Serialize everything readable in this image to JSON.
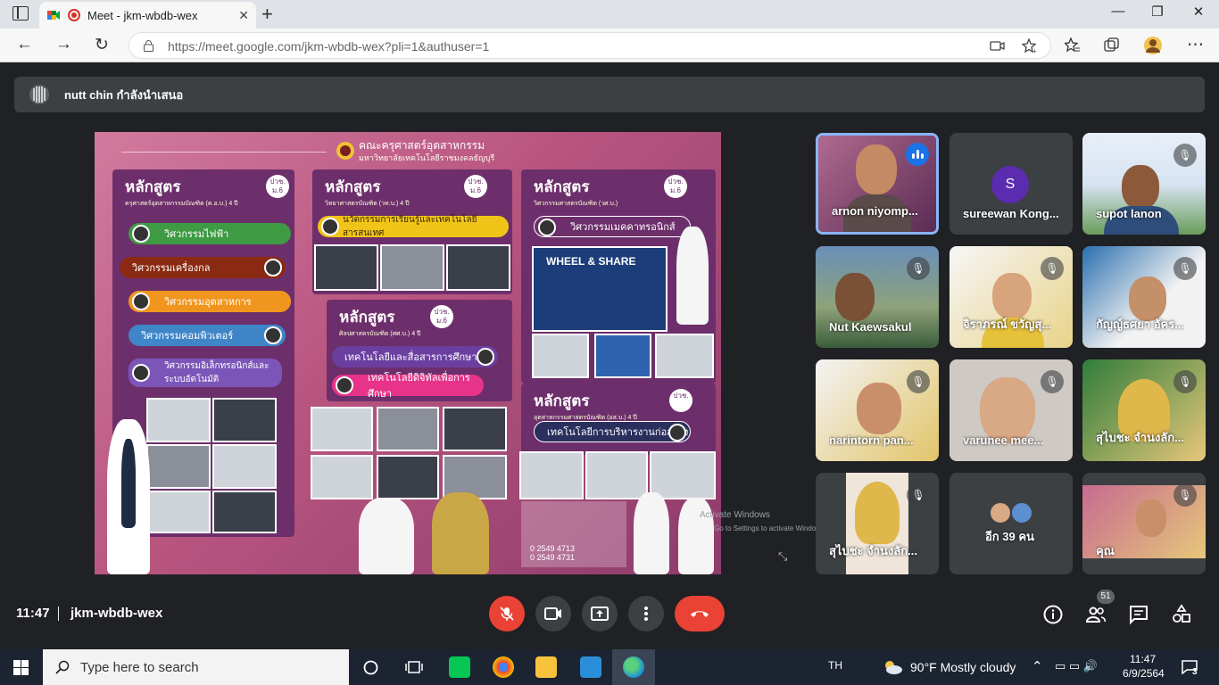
{
  "browser": {
    "tab_title": "Meet - jkm-wbdb-wex",
    "tab_close": "✕",
    "new_tab": "+",
    "url_host": "https://meet.google.com",
    "url_path": "/jkm-wbdb-wex?pli=1&authuser=1",
    "window_controls": [
      "—",
      "❐",
      "✕"
    ]
  },
  "meet": {
    "presenting_banner": "nutt chin กำลังนำเสนอ",
    "time": "11:47",
    "meeting_code": "jkm-wbdb-wex",
    "participant_count": "51",
    "watermark_line1": "Activate Windows",
    "watermark_line2": "Go to Settings to activate Windows."
  },
  "slide": {
    "header": "คณะครุศาสตร์อุตสาหกรรม",
    "subheader": "มหาวิทยาลัยเทคโนโลยีราชมงคลธัญบุรี",
    "columns": [
      {
        "title": "หลักสูตร",
        "badge": "ปวช. ม.6",
        "sub": "ครุศาสตร์อุตสาหกรรมบัณฑิต (ค.อ.บ.) 4 ปี",
        "items": [
          "วิศวกรรมไฟฟ้า",
          "วิศวกรรมเครื่องกล",
          "วิศวกรรมอุตสาหการ",
          "วิศวกรรมคอมพิวเตอร์",
          "วิศวกรรมอิเล็กทรอนิกส์และระบบอัตโนมัติ"
        ]
      },
      {
        "title": "หลักสูตร",
        "badge": "ปวช. ม.6",
        "sub": "วิทยาศาสตรบัณฑิต (วท.บ.) 4 ปี",
        "items": [
          "นวัตกรรมการเรียนรู้และเทคโนโลยีสารสนเทศ"
        ]
      },
      {
        "title": "หลักสูตร",
        "badge": "ปวช. ม.6",
        "sub": "ศิลปศาสตรบัณฑิต (ศศ.บ.) 4 ปี",
        "items": [
          "เทคโนโลยีและสื่อสารการศึกษา",
          "เทคโนโลยีดิจิทัลเพื่อการศึกษา"
        ]
      },
      {
        "title": "หลักสูตร",
        "badge": "ปวช. ม.6",
        "sub": "วิศวกรรมศาสตรบัณฑิต (วศ.บ.)",
        "items": [
          "วิศวกรรมเมคคาทรอนิกส์"
        ]
      },
      {
        "title": "หลักสูตร",
        "badge": "ปวช.",
        "sub": "อุตสาหกรรมศาสตรบัณฑิต (อส.บ.) 4 ปี",
        "items": [
          "เทคโนโลยีการบริหารงานก่อสร้าง"
        ]
      }
    ],
    "wheel_share": "WHEEL & SHARE",
    "phone1": "0 2549 4713",
    "phone2": "0 2549 4731"
  },
  "participants": [
    {
      "name": "arnon niyomp...",
      "speaking": true
    },
    {
      "name": "sureewan Kong...",
      "avatar_letter": "S"
    },
    {
      "name": "supot lanon",
      "muted": true
    },
    {
      "name": "Nut Kaewsakul",
      "muted": true
    },
    {
      "name": "จิราภรณ์ ขวัญสุ...",
      "muted": true
    },
    {
      "name": "กัญญ์ธศยา อัคร...",
      "muted": true
    },
    {
      "name": "narintorn pan...",
      "muted": true
    },
    {
      "name": "varunee mee...",
      "muted": true
    },
    {
      "name": "สุไบชะ จำนงลัก...",
      "muted": true
    },
    {
      "name": "สุไบชะ จำนงลัก...",
      "muted": true
    },
    {
      "name": "อีก 39 คน"
    },
    {
      "name": "คุณ",
      "muted": true
    }
  ],
  "taskbar": {
    "search_placeholder": "Type here to search",
    "lang": "TH",
    "weather": "90°F  Mostly cloudy",
    "time": "11:47",
    "date": "6/9/2564",
    "notification_count": "3"
  },
  "colors": {
    "meet_bg": "#202124",
    "tile_bg": "#3c4043",
    "end_call": "#ea4335",
    "active_border": "#8ab4f8"
  }
}
